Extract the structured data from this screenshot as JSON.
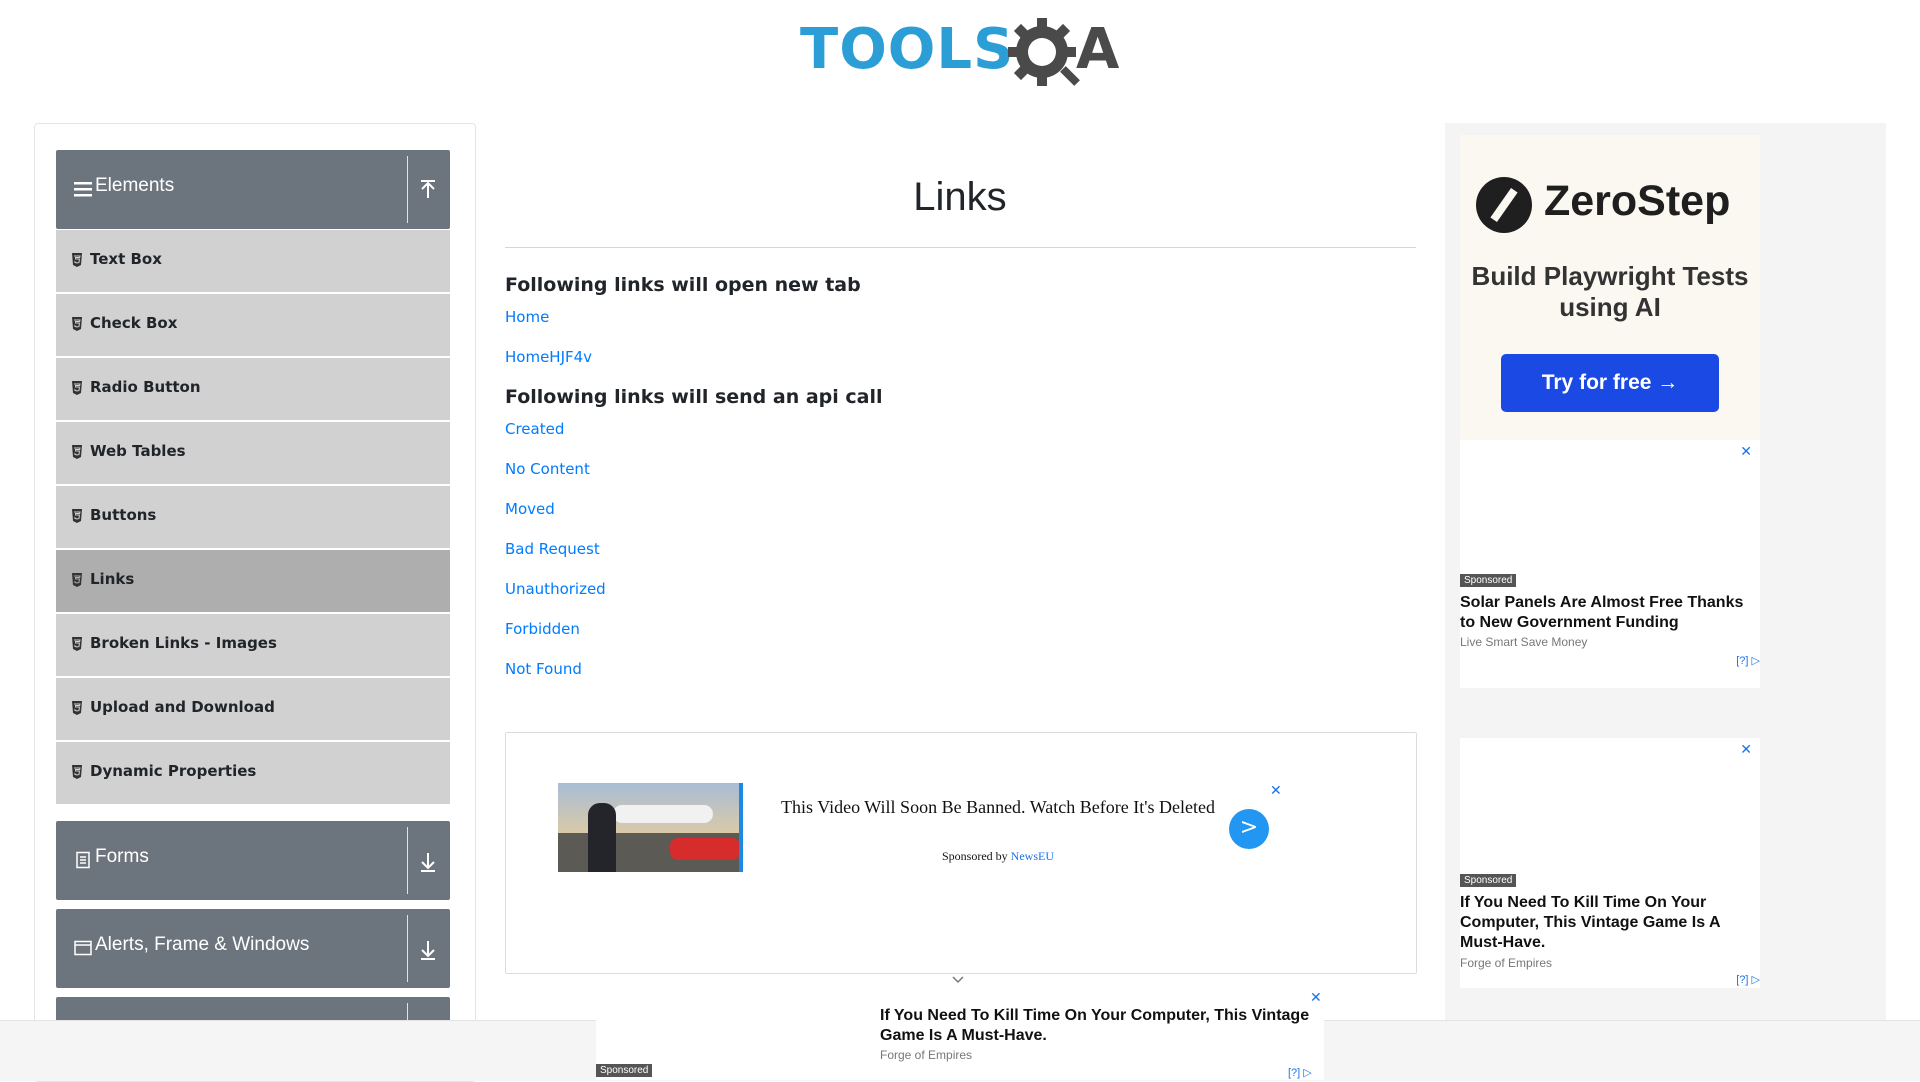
{
  "header": {
    "logo_text": "TOOLS",
    "logo_tail": "A"
  },
  "sidebar": {
    "groups": [
      {
        "title": "Elements",
        "icon": "hamburger-icon",
        "arrow": "arrow-up-icon"
      },
      {
        "title": "Forms",
        "icon": "document-icon",
        "arrow": "arrow-down-icon"
      },
      {
        "title": "Alerts, Frame & Windows",
        "icon": "window-icon",
        "arrow": "arrow-down-icon"
      }
    ],
    "items": [
      {
        "label": "Text Box"
      },
      {
        "label": "Check Box"
      },
      {
        "label": "Radio Button"
      },
      {
        "label": "Web Tables"
      },
      {
        "label": "Buttons"
      },
      {
        "label": "Links",
        "active": true
      },
      {
        "label": "Broken Links - Images"
      },
      {
        "label": "Upload and Download"
      },
      {
        "label": "Dynamic Properties"
      }
    ]
  },
  "main": {
    "title": "Links",
    "section_new_tab": "Following links will open new tab",
    "new_tab_links": [
      "Home",
      "HomeHJF4v"
    ],
    "section_api": "Following links will send an api call",
    "api_links": [
      "Created",
      "No Content",
      "Moved",
      "Bad Request",
      "Unauthorized",
      "Forbidden",
      "Not Found"
    ]
  },
  "center_ad": {
    "headline": "This Video Will Soon Be Banned. Watch Before It's Deleted",
    "sponsored_prefix": "Sponsored by ",
    "sponsor": "NewsEU",
    "go": ">",
    "close": "✕"
  },
  "right_ads": {
    "zerostep": {
      "name": "ZeroStep",
      "text": "Build Playwright Tests using AI",
      "button": "Try for free →"
    },
    "ad1": {
      "tag": "Sponsored",
      "headline": "Solar Panels Are Almost Free Thanks to New Government Funding",
      "source": "Live Smart Save Money",
      "close": "✕",
      "adchoice": "[?] ▷"
    },
    "ad2": {
      "tag": "Sponsored",
      "headline": "If You Need To Kill Time On Your Computer, This Vintage Game Is A Must-Have.",
      "source": "Forge of Empires",
      "close": "✕",
      "adchoice": "[?] ▷"
    }
  },
  "bottom_ad": {
    "headline": "If You Need To Kill Time On Your Computer, This Vintage Game Is A Must-Have.",
    "source": "Forge of Empires",
    "tag": "Sponsored",
    "close": "✕",
    "adchoice": "[?] ▷"
  },
  "colors": {
    "accent": "#2b9ed6",
    "link": "#007bff",
    "group_header": "#6c757d",
    "menu_item": "#d1d1d1",
    "menu_active": "#aeaeae",
    "cta": "#1a49e3"
  }
}
